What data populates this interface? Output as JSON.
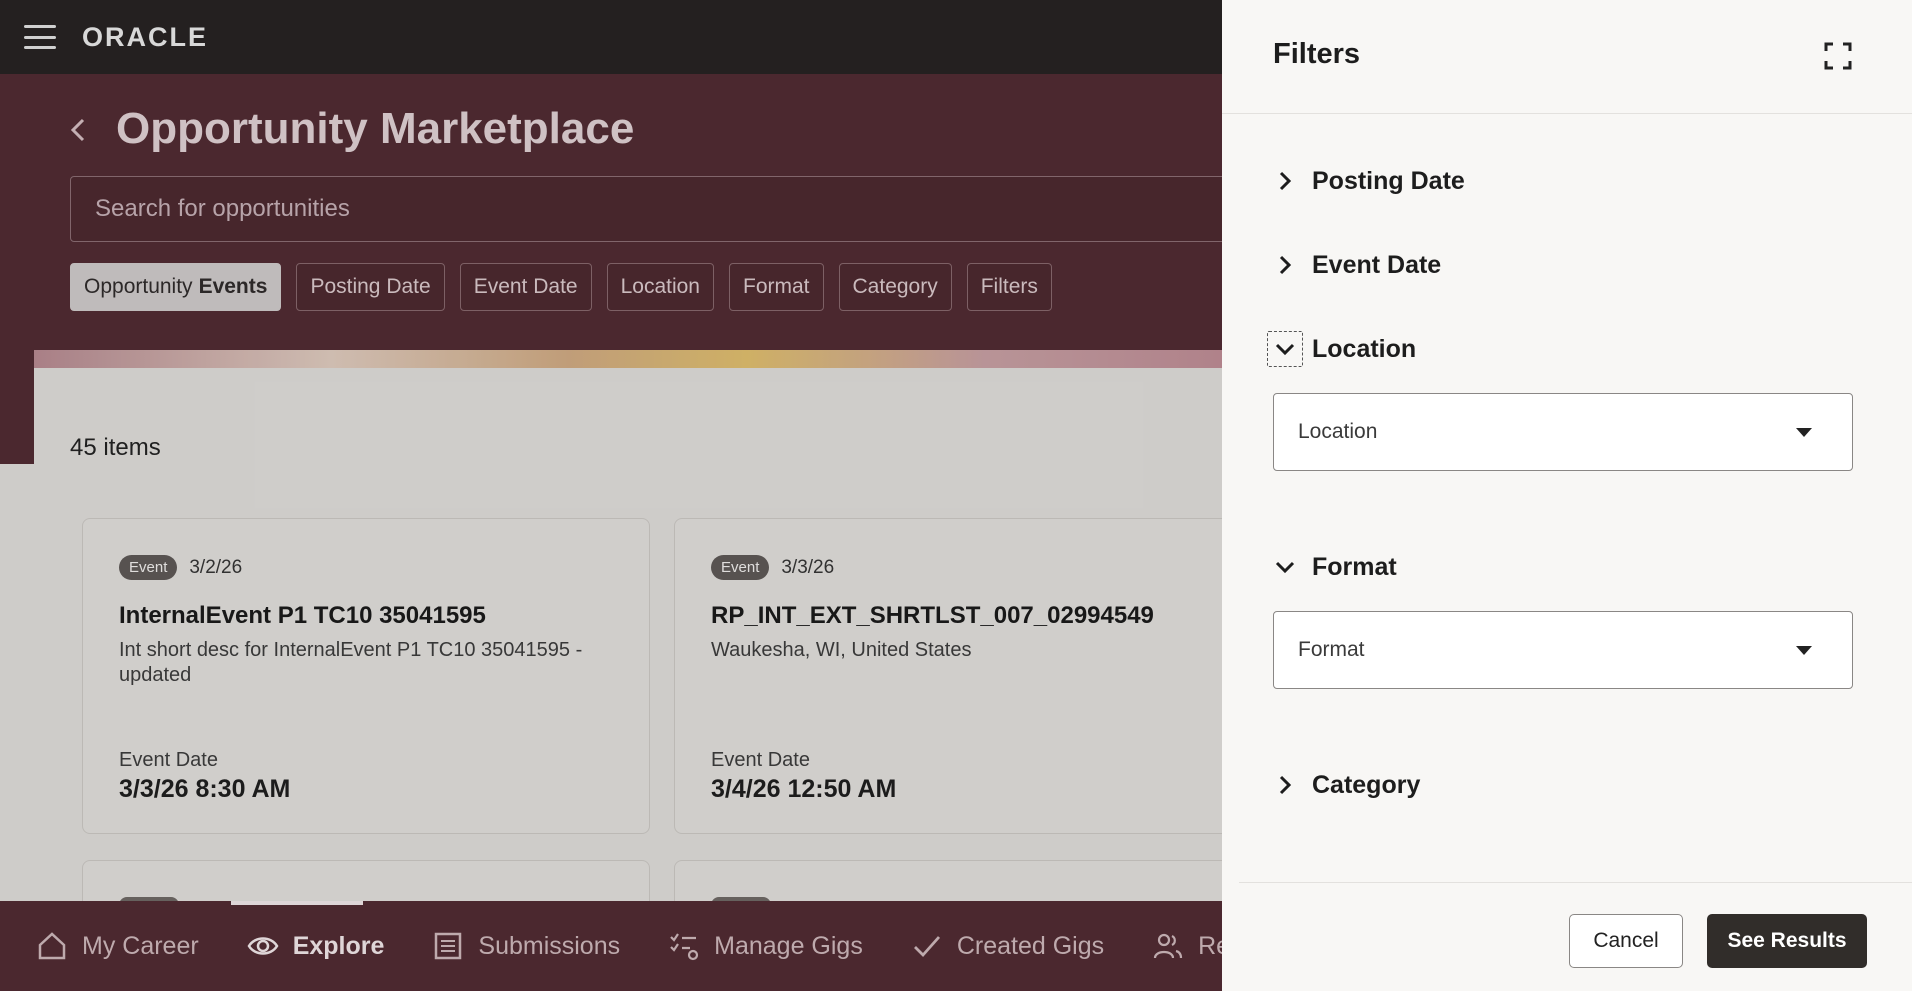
{
  "app": {
    "brand": "ORACLE",
    "page_title": "Opportunity Marketplace",
    "search": {
      "placeholder": "Search for opportunities"
    },
    "chips": {
      "active_prefix": "Opportunity",
      "active_suffix": "Events",
      "posting_date": "Posting Date",
      "event_date": "Event Date",
      "location": "Location",
      "format": "Format",
      "category": "Category",
      "filters": "Filters"
    },
    "items_count": "45 items",
    "cards": [
      {
        "badge": "Event",
        "date": "3/2/26",
        "title": "InternalEvent P1 TC10 35041595",
        "description": "Int short desc for InternalEvent P1 TC10 35041595 - updated",
        "event_date_label": "Event Date",
        "event_date_value": "3/3/26 8:30 AM"
      },
      {
        "badge": "Event",
        "date": "3/3/26",
        "title": "RP_INT_EXT_SHRTLST_007_02994549",
        "description": "Waukesha, WI, United States",
        "event_date_label": "Event Date",
        "event_date_value": "3/4/26 12:50 AM"
      }
    ],
    "bottom_nav": {
      "my_career": "My Career",
      "explore": "Explore",
      "submissions": "Submissions",
      "manage_gigs": "Manage Gigs",
      "created_gigs": "Created Gigs",
      "referrals_partial": "Ref"
    }
  },
  "drawer": {
    "title": "Filters",
    "sections": {
      "posting_date": "Posting Date",
      "event_date": "Event Date",
      "location": "Location",
      "format": "Format",
      "category": "Category"
    },
    "location_select": {
      "value": "Location"
    },
    "format_select": {
      "value": "Format"
    },
    "cancel_label": "Cancel",
    "see_results_label": "See Results"
  }
}
